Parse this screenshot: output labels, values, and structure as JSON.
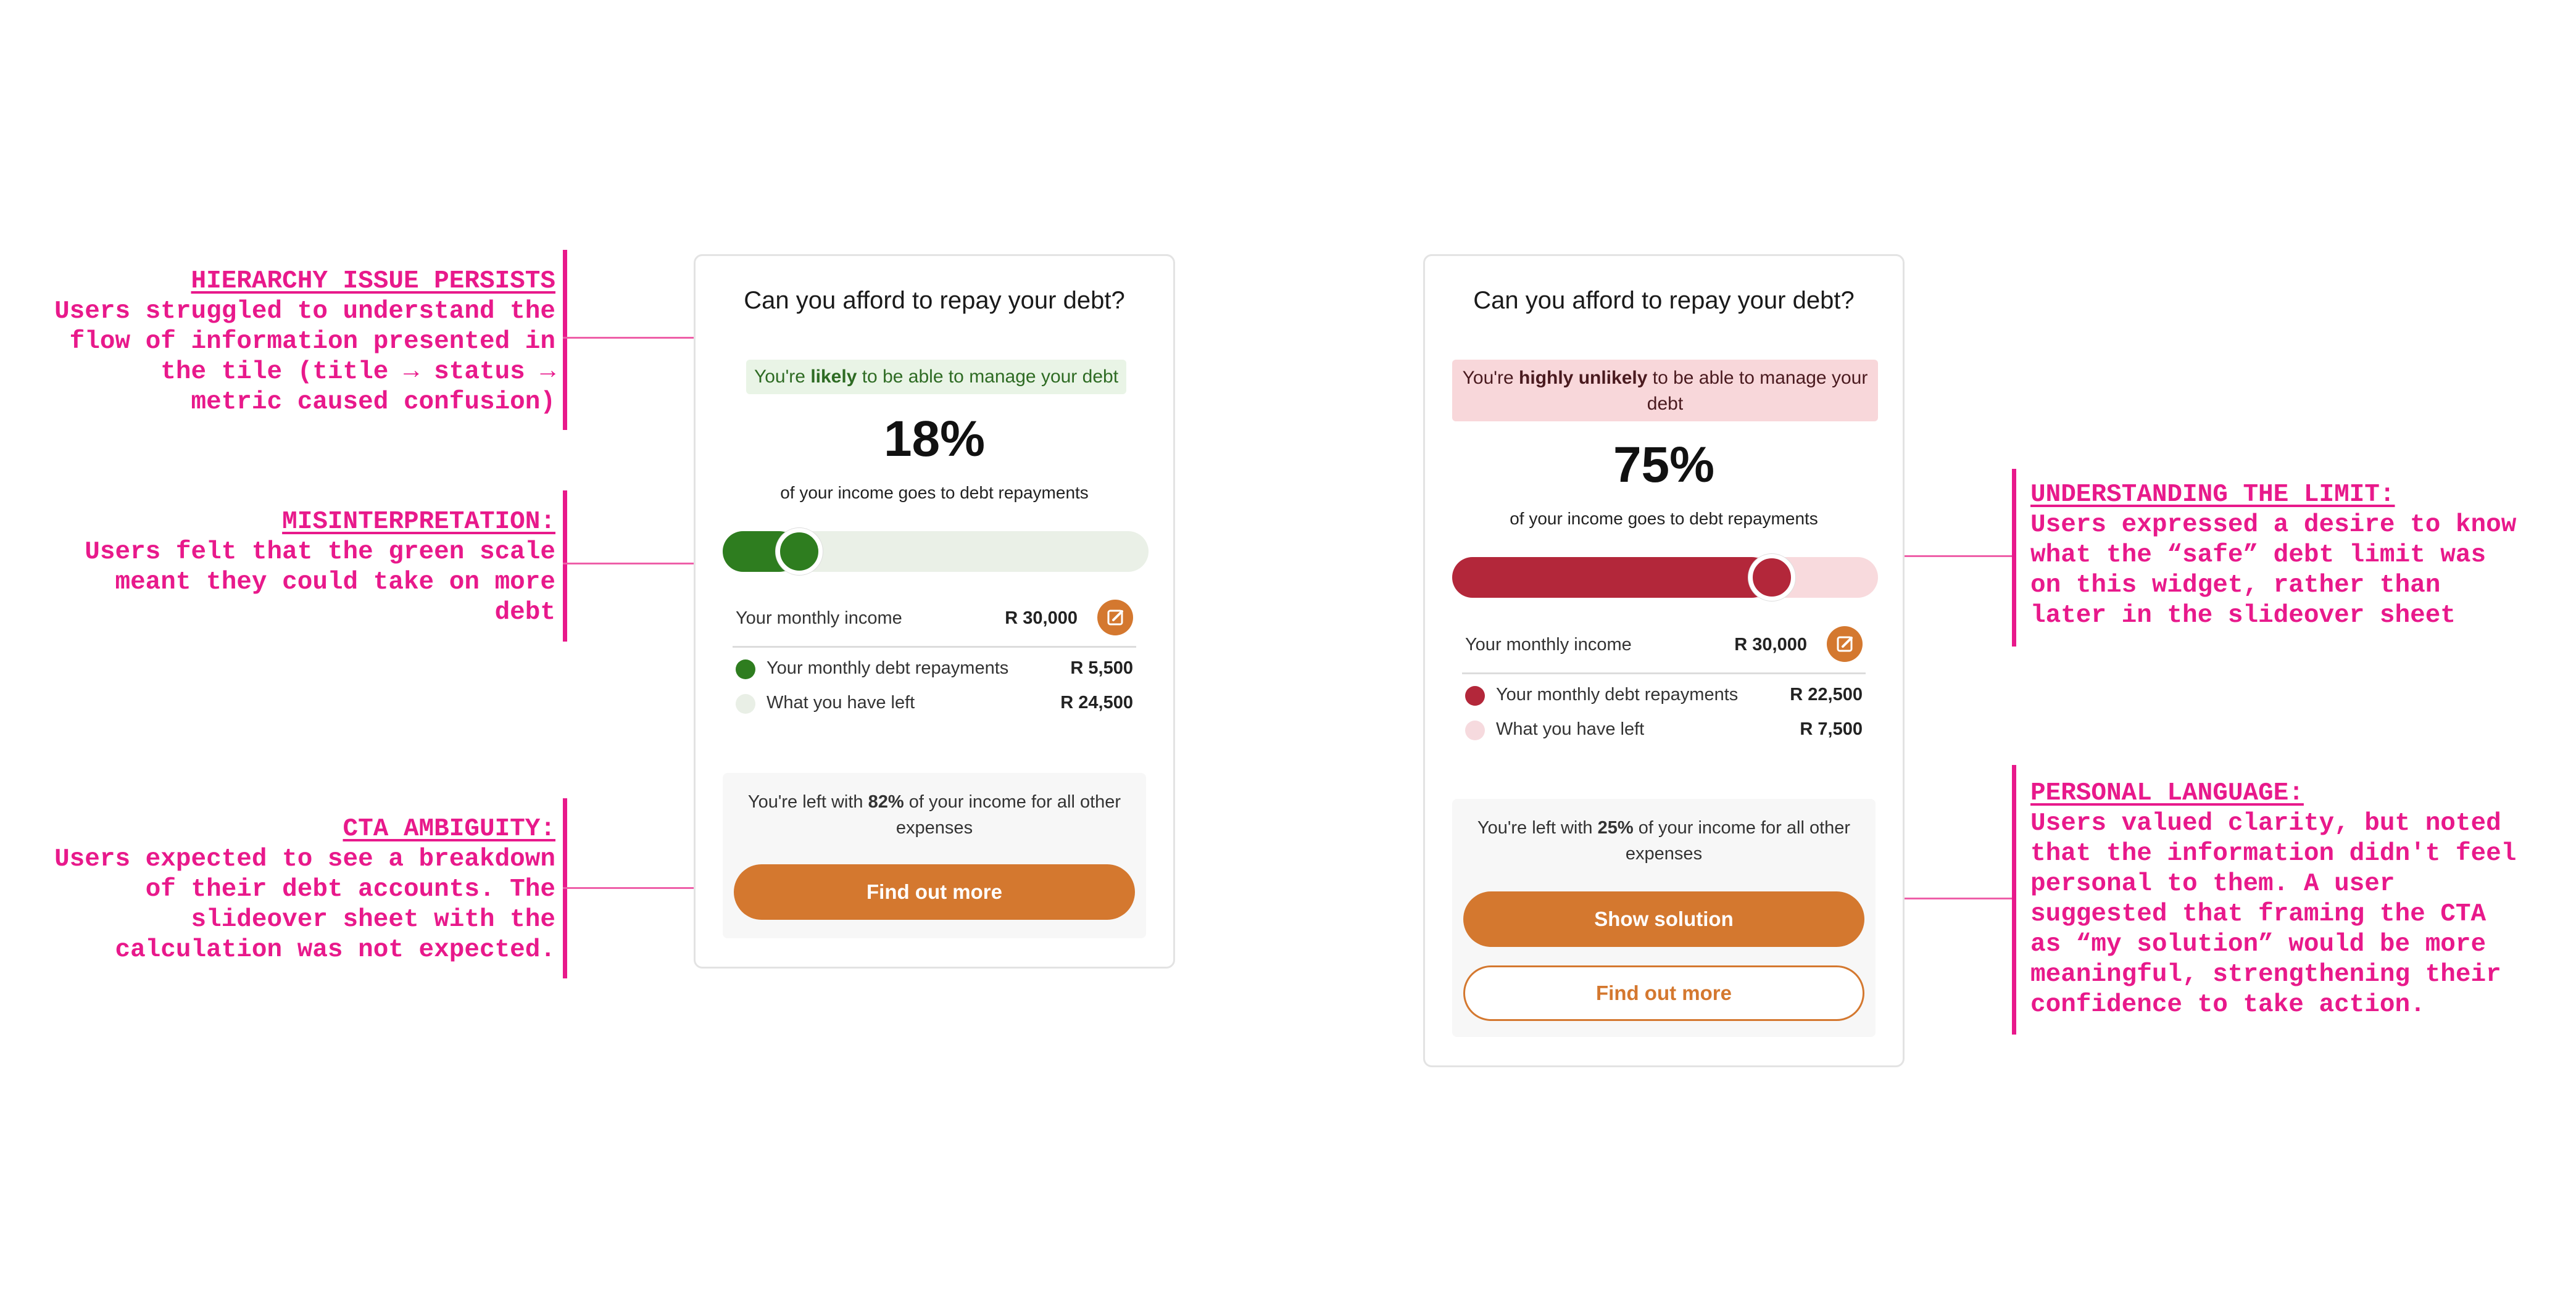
{
  "annotations": {
    "hierarchy": {
      "heading": "HIERARCHY ISSUE PERSISTS",
      "lines": [
        "Users struggled to understand the",
        "flow of information presented in",
        "the tile (title → status →",
        "metric caused confusion)"
      ]
    },
    "misinterpretation": {
      "heading": "MISINTERPRETATION:",
      "lines": [
        "Users felt that the green scale",
        "meant they could take on more",
        "debt"
      ]
    },
    "cta": {
      "heading": "CTA AMBIGUITY:",
      "lines": [
        "Users expected to see a breakdown",
        "of their debt accounts. The",
        "slideover sheet with the",
        "calculation was not expected."
      ]
    },
    "limit": {
      "heading": "UNDERSTANDING THE LIMIT:",
      "lines": [
        "Users expressed a desire to know",
        "what the “safe” debt limit was",
        "on this widget, rather than",
        "later in the slideover sheet"
      ]
    },
    "personal": {
      "heading": "PERSONAL LANGUAGE:",
      "lines": [
        "Users valued clarity, but noted",
        "that the information didn't feel",
        "personal to them. A user",
        "suggested that framing the CTA",
        "as “my solution” would be more",
        "meaningful, strengthening their",
        "confidence to take action."
      ]
    }
  },
  "card_a": {
    "title": "Can you afford to repay your debt?",
    "status_pre": "You're ",
    "status_strong": "likely",
    "status_post": " to be able to manage your debt",
    "percent": "18%",
    "percent_caption": "of your income goes to debt repayments",
    "gauge_fraction": 0.18,
    "income_label": "Your monthly income",
    "income_value": "R 30,000",
    "repay_label": "Your monthly debt repayments",
    "repay_value": "R 5,500",
    "left_label": "What you have left",
    "left_value": "R 24,500",
    "summary_pre": "You're left with ",
    "summary_strong": "82%",
    "summary_post": " of your income for all other expenses",
    "primary_button": "Find out more",
    "colors": {
      "fill": "#2e7d1f",
      "track": "#eaf0e7",
      "status_bg": "#e9f4e6",
      "status_text": "#2e6b23",
      "left_dot": "#e9efe6"
    }
  },
  "card_b": {
    "title": "Can you afford to repay your debt?",
    "status_pre": "You're ",
    "status_strong": "highly unlikely",
    "status_post": " to be able to manage your debt",
    "percent": "75%",
    "percent_caption": "of your income goes to debt repayments",
    "gauge_fraction": 0.75,
    "income_label": "Your monthly income",
    "income_value": "R 30,000",
    "repay_label": "Your monthly debt repayments",
    "repay_value": "R 22,500",
    "left_label": "What you have left",
    "left_value": "R 7,500",
    "summary_pre": "You're left with ",
    "summary_strong": "25%",
    "summary_post": " of your income for all other expenses",
    "primary_button": "Show solution",
    "secondary_button": "Find out more",
    "colors": {
      "fill": "#b3273a",
      "track": "#f8dadd",
      "status_bg": "#f8d7da",
      "status_text": "#4a1a1f",
      "left_dot": "#f6dade"
    }
  }
}
